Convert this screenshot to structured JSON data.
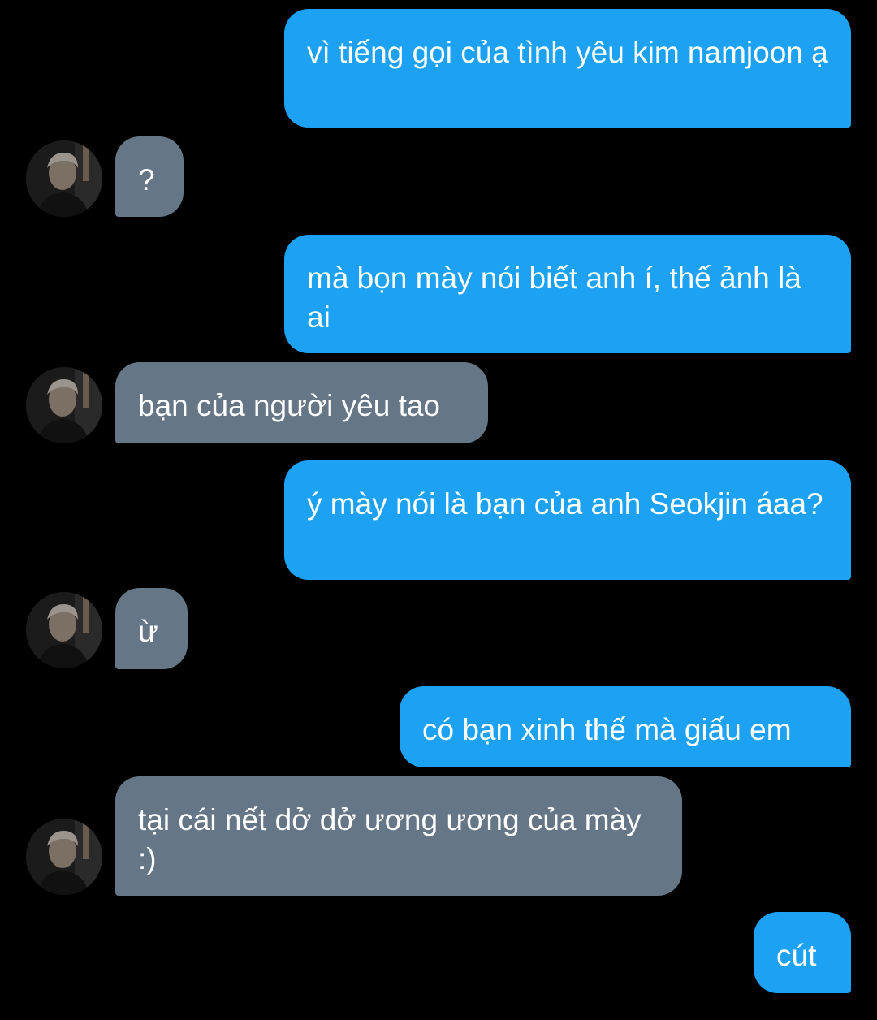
{
  "conversation": {
    "messages": [
      {
        "side": "sent",
        "text": "vì tiếng gọi của tình yêu kim namjoon ạ"
      },
      {
        "side": "received",
        "text": "?"
      },
      {
        "side": "sent",
        "text": "mà bọn mày nói biết anh í, thế ảnh là ai"
      },
      {
        "side": "received",
        "text": "bạn của người yêu tao"
      },
      {
        "side": "sent",
        "text": "ý mày nói là bạn của anh Seokjin áaa?"
      },
      {
        "side": "received",
        "text": "ừ"
      },
      {
        "side": "sent",
        "text": "có bạn xinh thế mà giấu em"
      },
      {
        "side": "received",
        "text": "tại cái nết dở dở ương ương của mày :)"
      },
      {
        "side": "sent",
        "text": "cút"
      }
    ]
  },
  "colors": {
    "sent_bubble": "#1da1f2",
    "received_bubble": "#657786",
    "background": "#000000",
    "text": "#ffffff"
  },
  "icons": {
    "avatar": "contact-avatar-photo"
  }
}
